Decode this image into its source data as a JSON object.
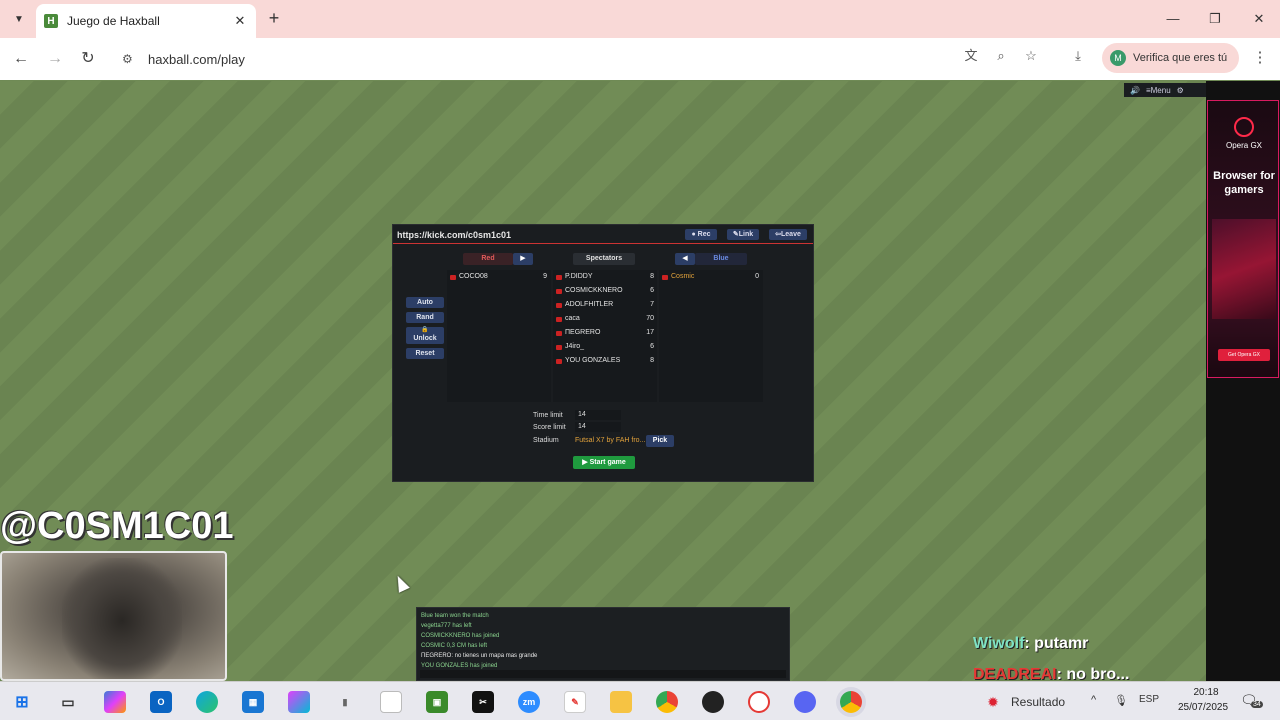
{
  "browser": {
    "tab_title": "Juego de Haxball",
    "favicon_letter": "H",
    "url": "haxball.com/play",
    "profile_chip": "Verifica que eres tú",
    "profile_initial": "M",
    "icons": [
      "tab-search-icon",
      "close-icon",
      "new-tab-icon",
      "minimize-icon",
      "restore-icon",
      "window-close-icon",
      "back-icon",
      "forward-icon",
      "reload-icon",
      "site-info-icon",
      "translate-icon",
      "zoom-icon",
      "bookmark-star-icon",
      "download-icon",
      "menu-kebab-icon"
    ]
  },
  "game": {
    "topbar_menu": "≡Menu",
    "room": {
      "title": "https://kick.com/c0sm1c01",
      "buttons": {
        "rec": "● Rec",
        "link": "✎Link",
        "leave": "⇦Leave"
      },
      "left_buttons": {
        "auto": "Auto",
        "rand": "Rand",
        "unlock": "Unlock",
        "reset": "Reset"
      },
      "red": {
        "label": "Red",
        "players": [
          {
            "name": "COCO08",
            "ping": "9"
          }
        ]
      },
      "spectators": {
        "label": "Spectators",
        "players": [
          {
            "name": "P.DIDDY",
            "ping": "8"
          },
          {
            "name": "COSMICKKNERO",
            "ping": "6"
          },
          {
            "name": "ADOLFHITLER",
            "ping": "7"
          },
          {
            "name": "caca",
            "ping": "70"
          },
          {
            "name": "ΠΕGRERO",
            "ping": "17"
          },
          {
            "name": "J4iro_",
            "ping": "6"
          },
          {
            "name": "YOU GONZALES",
            "ping": "8"
          }
        ]
      },
      "blue": {
        "label": "Blue",
        "players": [
          {
            "name": "Cosmic",
            "ping": "0"
          }
        ]
      },
      "settings": {
        "time_limit_label": "Time limit",
        "time_limit": "14",
        "score_limit_label": "Score limit",
        "score_limit": "14",
        "stadium_label": "Stadium",
        "stadium": "Futsal X7 by FAH fro...",
        "pick": "Pick",
        "start": "▶ Start game"
      }
    },
    "chat": [
      {
        "text": "Blue team won the match"
      },
      {
        "text": "vegetta777 has left"
      },
      {
        "text": "COSMICKKNERO has joined"
      },
      {
        "text": "COSMIC 0,3 CM has left"
      },
      {
        "text": "ΠΕGRERO: no tienes un mapa mas grande",
        "white": true
      },
      {
        "text": "YOU GONZALES has joined"
      }
    ]
  },
  "stream_overlay": {
    "handle": "@C0SM1C01",
    "chat": [
      {
        "user": "Wiwolf",
        "message": ": putamr"
      },
      {
        "user": "DEADREAI",
        "message": ": no bro..."
      }
    ]
  },
  "ad": {
    "brand": "Opera GX",
    "headline": "Browser for gamers",
    "cta": "Get Opera GX"
  },
  "taskbar": {
    "weather": "Resultado",
    "language": "ESP",
    "time": "20:18",
    "date": "25/07/2025",
    "notifications": "34",
    "apps": [
      "windows-start-icon",
      "task-view-icon",
      "copilot-icon",
      "outlook-icon",
      "edge-icon",
      "store-icon",
      "microsoft365-icon",
      "mouse-app-icon",
      "notepad-icon",
      "minecraft-icon",
      "capcut-icon",
      "zoom-app-icon",
      "paint-app-icon",
      "file-explorer-icon",
      "chrome-icon",
      "obs-icon",
      "opera-gx-icon",
      "discord-icon",
      "chrome-active-icon"
    ]
  }
}
